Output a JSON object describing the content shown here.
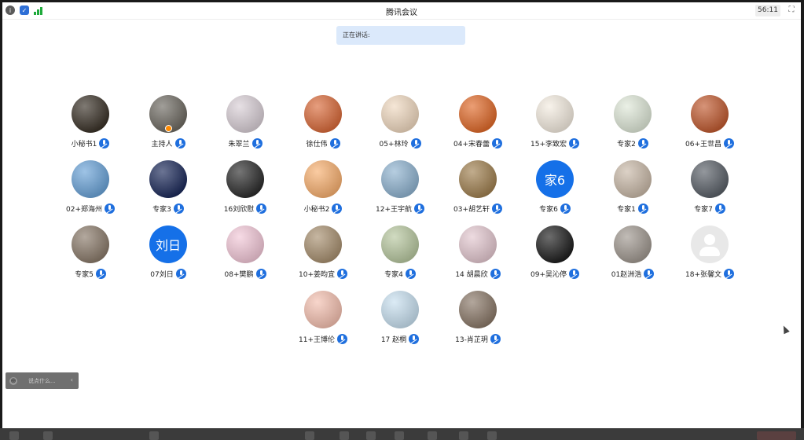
{
  "window": {
    "title": "腾讯会议",
    "timer": "56:11"
  },
  "speaking": {
    "label": "正在讲话:"
  },
  "participants": [
    {
      "name": "小秘书1",
      "avatar_color": "#3a3228"
    },
    {
      "name": "主持人",
      "avatar_color": "#6e6a62",
      "host": true
    },
    {
      "name": "朱翠兰",
      "avatar_color": "#d9cfd6"
    },
    {
      "name": "徐仕伟",
      "avatar_color": "#d96a3a"
    },
    {
      "name": "05+林玲",
      "avatar_color": "#f0d9c0"
    },
    {
      "name": "04+宋春蕾",
      "avatar_color": "#e06a2a"
    },
    {
      "name": "15+李致宏",
      "avatar_color": "#f4ece0"
    },
    {
      "name": "专家2",
      "avatar_color": "#dfe8d8"
    },
    {
      "name": "06+王世昌",
      "avatar_color": "#c05a30"
    },
    {
      "name": "02+郑海州",
      "avatar_color": "#6aa3d8"
    },
    {
      "name": "专家3",
      "avatar_color": "#1c2a5a"
    },
    {
      "name": "16刘欣慰",
      "avatar_color": "#2c2c2c"
    },
    {
      "name": "小秘书2",
      "avatar_color": "#f8b070"
    },
    {
      "name": "12+王宇航",
      "avatar_color": "#8fb3d0"
    },
    {
      "name": "03+胡艺轩",
      "avatar_color": "#a08050"
    },
    {
      "name": "专家6",
      "avatar_color": "#1570e8",
      "text": "家6"
    },
    {
      "name": "专家1",
      "avatar_color": "#c9b9a8"
    },
    {
      "name": "专家7",
      "avatar_color": "#5a6068"
    },
    {
      "name": "专家5",
      "avatar_color": "#8a7a6a"
    },
    {
      "name": "07刘日",
      "avatar_color": "#1570e8",
      "text": "刘日"
    },
    {
      "name": "08+樊鹏",
      "avatar_color": "#f3c8d8"
    },
    {
      "name": "10+姜昀宜",
      "avatar_color": "#a89070"
    },
    {
      "name": "专家4",
      "avatar_color": "#b8c8a0"
    },
    {
      "name": "14 胡晨欣",
      "avatar_color": "#e4c8d0"
    },
    {
      "name": "09+吴沁停",
      "avatar_color": "#1e1e1e"
    },
    {
      "name": "01赵洲浩",
      "avatar_color": "#a09890"
    },
    {
      "name": "18+张馨文",
      "avatar_color": "#e8e8e8",
      "placeholder": true
    },
    {
      "name": "11+王博伦",
      "avatar_color": "#f4c0b0"
    },
    {
      "name": "17 赵桐",
      "avatar_color": "#c8e0f0"
    },
    {
      "name": "13-肖芷玥",
      "avatar_color": "#8a7868"
    }
  ],
  "chat": {
    "placeholder": "说点什么..."
  },
  "colors": {
    "accent": "#1f6fde",
    "speaking_bg": "#dbe9fb",
    "toolbar": "#3b3b3b"
  }
}
